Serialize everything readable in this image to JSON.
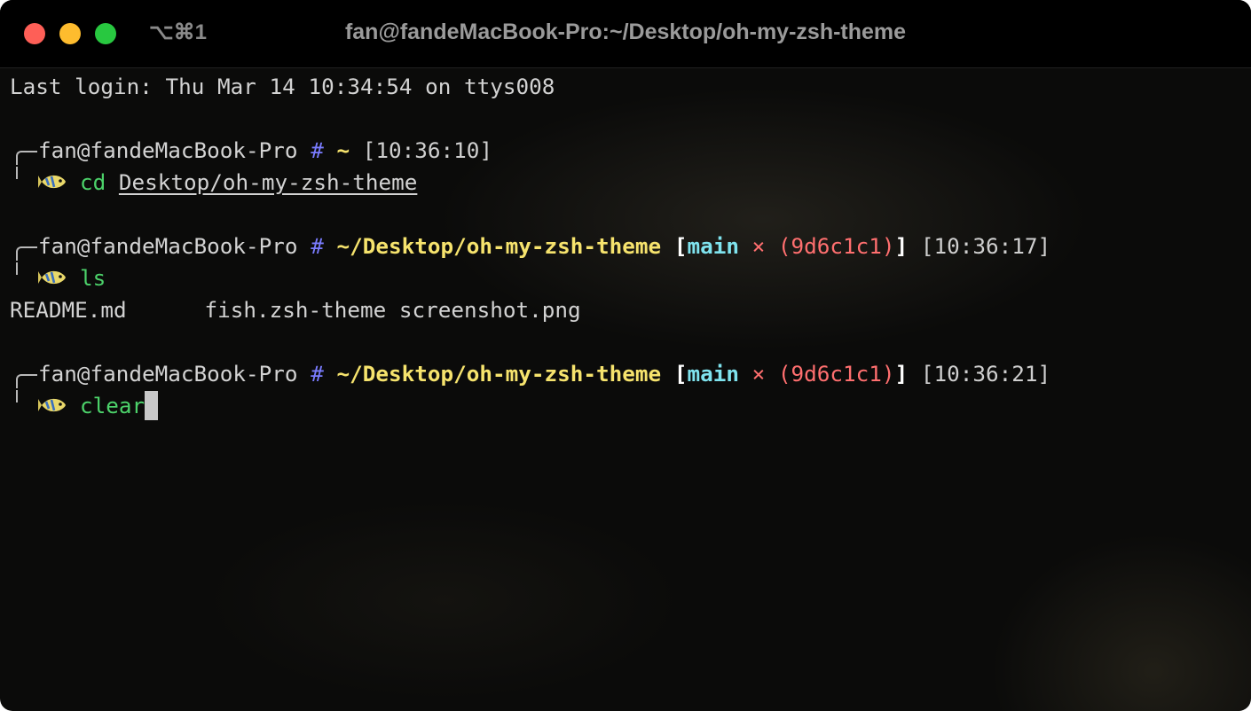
{
  "window": {
    "shortcut": "⌥⌘1",
    "title": "fan@fandeMacBook-Pro:~/Desktop/oh-my-zsh-theme"
  },
  "terminal": {
    "last_login": "Last login: Thu Mar 14 10:34:54 on ttys008",
    "prompts": [
      {
        "user_host": "fan@fandeMacBook-Pro",
        "hash": "#",
        "path": "~",
        "time": "[10:36:10]",
        "command": "cd",
        "argument": "Desktop/oh-my-zsh-theme"
      },
      {
        "user_host": "fan@fandeMacBook-Pro",
        "hash": "#",
        "path": "~/Desktop/oh-my-zsh-theme",
        "branch": "main",
        "dirty_mark": "×",
        "sha": "(9d6c1c1)",
        "time": "[10:36:17]",
        "command": "ls"
      },
      {
        "user_host": "fan@fandeMacBook-Pro",
        "hash": "#",
        "path": "~/Desktop/oh-my-zsh-theme",
        "branch": "main",
        "dirty_mark": "×",
        "sha": "(9d6c1c1)",
        "time": "[10:36:21]",
        "command": "clear"
      }
    ],
    "ls_output": {
      "file1": "README.md",
      "file2": "fish.zsh-theme",
      "file3": "screenshot.png"
    }
  },
  "icons": {
    "prompt_symbol": "fish-icon"
  },
  "colors": {
    "hash": "#7a7cff",
    "path": "#f6e36d",
    "branch": "#7fe3ee",
    "sha": "#ff6f6f",
    "command": "#4cd26a"
  }
}
